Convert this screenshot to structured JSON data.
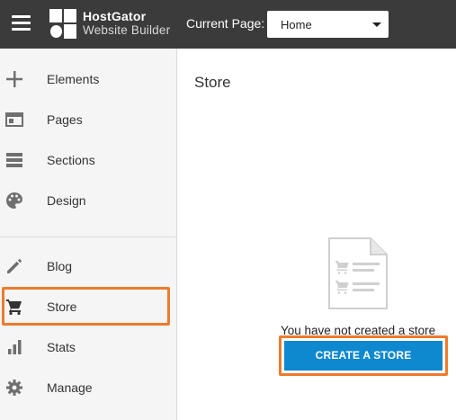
{
  "topbar": {
    "menu_icon": "hamburger-icon",
    "brand_name": "HostGator",
    "brand_product": "Website Builder",
    "current_page_label": "Current Page:",
    "current_page_value": "Home",
    "background_color": "#3b3b3b"
  },
  "sidebar": {
    "items": [
      {
        "label": "Elements",
        "icon": "plus-icon"
      },
      {
        "label": "Pages",
        "icon": "page-icon"
      },
      {
        "label": "Sections",
        "icon": "sections-icon"
      },
      {
        "label": "Design",
        "icon": "palette-icon"
      },
      {
        "label": "Blog",
        "icon": "pencil-icon"
      },
      {
        "label": "Store",
        "icon": "cart-icon",
        "selected": true
      },
      {
        "label": "Stats",
        "icon": "bar-chart-icon"
      },
      {
        "label": "Manage",
        "icon": "gear-icon"
      }
    ]
  },
  "main": {
    "title": "Store",
    "empty_message": "You have not created a store",
    "create_button": "CREATE A STORE",
    "button_color": "#0e88cf",
    "highlight_color": "#ef7a2c"
  }
}
